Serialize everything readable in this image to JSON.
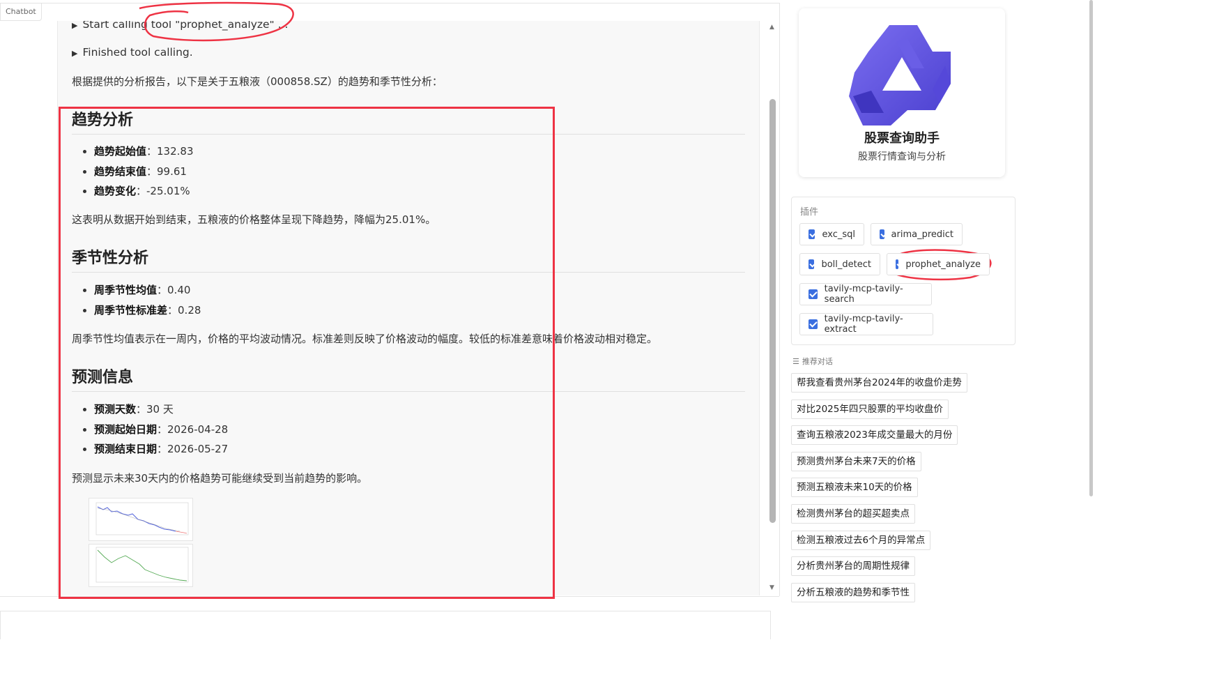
{
  "chatbot_label": "Chatbot",
  "messages": {
    "tool_start": "Start calling tool \"prophet_analyze\" ...",
    "tool_finished": "Finished tool calling.",
    "intro": "根据提供的分析报告，以下是关于五粮液（000858.SZ）的趋势和季节性分析：",
    "sections": [
      {
        "heading": "趋势分析",
        "items": [
          {
            "label": "趋势起始值",
            "value": "：132.83"
          },
          {
            "label": "趋势结束值",
            "value": "：99.61"
          },
          {
            "label": "趋势变化",
            "value": "：-25.01%"
          }
        ],
        "summary": "这表明从数据开始到结束，五粮液的价格整体呈现下降趋势，降幅为25.01%。"
      },
      {
        "heading": "季节性分析",
        "items": [
          {
            "label": "周季节性均值",
            "value": "：0.40"
          },
          {
            "label": "周季节性标准差",
            "value": "：0.28"
          }
        ],
        "summary": "周季节性均值表示在一周内，价格的平均波动情况。标准差则反映了价格波动的幅度。较低的标准差意味着价格波动相对稳定。"
      },
      {
        "heading": "预测信息",
        "items": [
          {
            "label": "预测天数",
            "value": "：30 天"
          },
          {
            "label": "预测起始日期",
            "value": "：2026-04-28"
          },
          {
            "label": "预测结束日期",
            "value": "：2026-05-27"
          }
        ],
        "summary": "预测显示未来30天内的价格趋势可能继续受到当前趋势的影响。"
      }
    ]
  },
  "sidebar": {
    "app_title": "股票查询助手",
    "app_subtitle": "股票行情查询与分析",
    "plugins_title": "插件",
    "plugins": [
      {
        "label": "exc_sql",
        "checked": true
      },
      {
        "label": "arima_predict",
        "checked": true
      },
      {
        "label": "boll_detect",
        "checked": true
      },
      {
        "label": "prophet_analyze",
        "checked": true
      },
      {
        "label": "tavily-mcp-tavily-search",
        "checked": true
      },
      {
        "label": "tavily-mcp-tavily-extract",
        "checked": true
      }
    ],
    "recommend_title": "推荐对话",
    "recommendations": [
      "帮我查看贵州茅台2024年的收盘价走势",
      "对比2025年四只股票的平均收盘价",
      "查询五粮液2023年成交量最大的月份",
      "预测贵州茅台未来7天的价格",
      "预测五粮液未来10天的价格",
      "检测贵州茅台的超买超卖点",
      "检测五粮液过去6个月的异常点",
      "分析贵州茅台的周期性规律",
      "分析五粮液的趋势和季节性"
    ]
  },
  "colors": {
    "accent": "#3b6fe0",
    "annotation": "#ee3344",
    "logo": "#5a4fd8"
  },
  "icons": [
    "caret-right-icon",
    "checkbox-icon",
    "list-icon",
    "logo-icon"
  ]
}
